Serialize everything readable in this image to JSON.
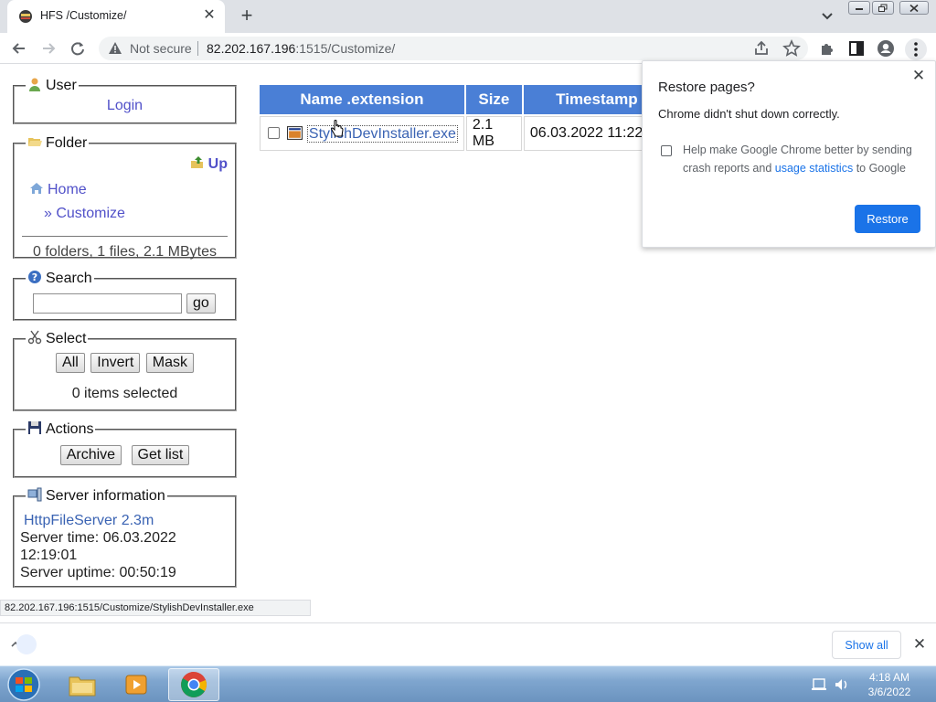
{
  "browser": {
    "tab_title": "HFS /Customize/",
    "not_secure": "Not secure",
    "url_host": "82.202.167.196",
    "url_rest": ":1515/Customize/"
  },
  "sidebar": {
    "user": {
      "legend": "User",
      "login": "Login"
    },
    "folder": {
      "legend": "Folder",
      "up": "Up",
      "home": "Home",
      "current": "» Customize",
      "summary": "0 folders, 1 files, 2.1 MBytes"
    },
    "search": {
      "legend": "Search",
      "value": "",
      "go": "go"
    },
    "select": {
      "legend": "Select",
      "all": "All",
      "invert": "Invert",
      "mask": "Mask",
      "count": "0 items selected"
    },
    "actions": {
      "legend": "Actions",
      "archive": "Archive",
      "get_list": "Get list"
    },
    "server": {
      "legend": "Server information",
      "name": "HttpFileServer 2.3m",
      "time_line1": "Server time: 06.03.2022",
      "time_line2": "12:19:01",
      "uptime": "Server uptime: 00:50:19"
    }
  },
  "file_table": {
    "headers": [
      "Name .extension",
      "Size",
      "Timestamp"
    ],
    "rows": [
      {
        "name": "StylishDevInstaller.exe",
        "size": "2.1 MB",
        "timestamp": "06.03.2022 11:22"
      }
    ]
  },
  "restore_bubble": {
    "title": "Restore pages?",
    "message": "Chrome didn't shut down correctly.",
    "help_prefix": "Help make Google Chrome better by sending crash reports and ",
    "help_link": "usage statistics",
    "help_suffix": " to Google",
    "button": "Restore"
  },
  "status_url": "82.202.167.196:1515/Customize/StylishDevInstaller.exe",
  "download_shelf": {
    "show_all": "Show all"
  },
  "taskbar": {
    "time": "4:18 AM",
    "date": "3/6/2022"
  },
  "colors": {
    "header_blue": "#4a7fd6",
    "link": "#5151c9",
    "chrome_blue": "#1a73e8"
  }
}
